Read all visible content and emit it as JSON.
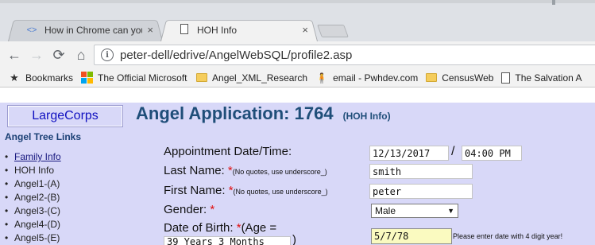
{
  "tabs": [
    {
      "title": "How in Chrome can you",
      "close": "×",
      "state": "inactive"
    },
    {
      "title": "HOH Info",
      "close": "×",
      "state": "active"
    }
  ],
  "toolbar": {
    "back": "←",
    "forward": "→",
    "reload": "⟳",
    "home": "⌂",
    "info": "i",
    "url": "peter-dell/edrive/AngelWebSQL/profile2.asp"
  },
  "bookmarks": [
    {
      "label": "Bookmarks",
      "icon": "star-icon"
    },
    {
      "label": "The Official Microsoft",
      "icon": "microsoft-icon"
    },
    {
      "label": "Angel_XML_Research",
      "icon": "folder-icon"
    },
    {
      "label": "email - Pwhdev.com",
      "icon": "person-icon"
    },
    {
      "label": "CensusWeb",
      "icon": "folder-icon"
    },
    {
      "label": "The Salvation A",
      "icon": "page-icon"
    }
  ],
  "sidebar": {
    "brand": "LargeCorps",
    "heading": "Angel Tree Links",
    "items": [
      {
        "label": "Family Info",
        "link": true
      },
      {
        "label": "HOH Info",
        "link": false
      },
      {
        "label": "Angel1-(A)",
        "link": false
      },
      {
        "label": "Angel2-(B)",
        "link": false
      },
      {
        "label": "Angel3-(C)",
        "link": false
      },
      {
        "label": "Angel4-(D)",
        "link": false
      },
      {
        "label": "Angel5-(E)",
        "link": false
      }
    ]
  },
  "main": {
    "title": "Angel Application: 1764",
    "subtitle": "(HOH Info)",
    "form": {
      "appointment_label": "Appointment Date/Time:",
      "appointment_date": "12/13/2017",
      "appointment_sep": "/",
      "appointment_time": "04:00 PM",
      "last_name_label": "Last Name:",
      "last_name_req": "*",
      "last_name_note": "(No quotes, use underscore_)",
      "last_name_value": "smith",
      "first_name_label": "First Name:",
      "first_name_req": "*",
      "first_name_note": "(No quotes, use underscore_)",
      "first_name_value": "peter",
      "gender_label": "Gender:",
      "gender_req": "*",
      "gender_value": "Male",
      "gender_caret": "▼",
      "dob_label": "Date of Birth:",
      "dob_req": "*",
      "dob_age_prefix": "(Age =",
      "dob_age_value": "39 Years 3 Months",
      "dob_age_suffix": ")",
      "dob_value": "5/7/78",
      "dob_hint": "Please enter date with 4 digit year!"
    }
  },
  "colors": {
    "page_bg": "#d8d8f8",
    "title": "#1f4e79",
    "required": "#e01010",
    "highlight_input": "#fafac0"
  }
}
